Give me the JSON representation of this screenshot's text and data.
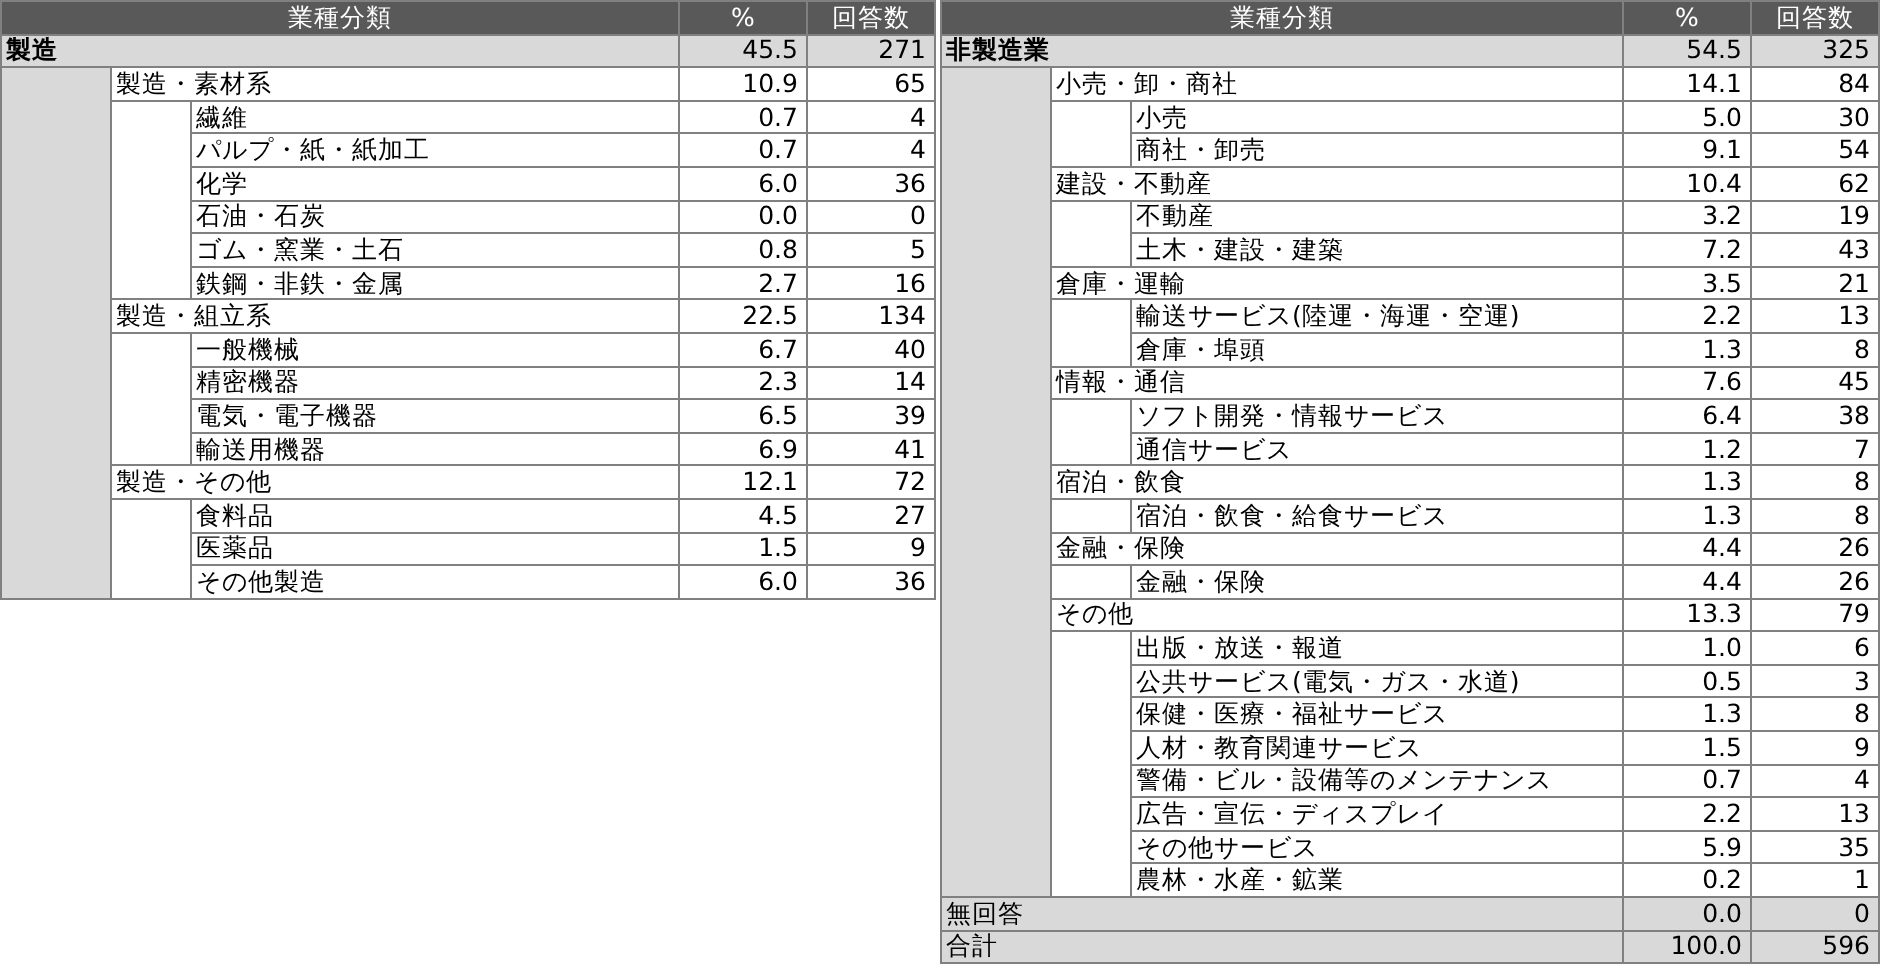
{
  "tables": [
    {
      "columns": [
        "業種分類",
        "%",
        "回答数"
      ],
      "rows": [
        {
          "kind": "sector",
          "label": "製造",
          "percent": "45.5",
          "count": "271",
          "children": [
            {
              "label": "製造・素材系",
              "percent": "10.9",
              "count": "65",
              "children": [
                {
                  "label": "繊維",
                  "percent": "0.7",
                  "count": "4"
                },
                {
                  "label": "パルプ・紙・紙加工",
                  "percent": "0.7",
                  "count": "4"
                },
                {
                  "label": "化学",
                  "percent": "6.0",
                  "count": "36"
                },
                {
                  "label": "石油・石炭",
                  "percent": "0.0",
                  "count": "0"
                },
                {
                  "label": "ゴム・窯業・土石",
                  "percent": "0.8",
                  "count": "5"
                },
                {
                  "label": "鉄鋼・非鉄・金属",
                  "percent": "2.7",
                  "count": "16"
                }
              ]
            },
            {
              "label": "製造・組立系",
              "percent": "22.5",
              "count": "134",
              "children": [
                {
                  "label": "一般機械",
                  "percent": "6.7",
                  "count": "40"
                },
                {
                  "label": "精密機器",
                  "percent": "2.3",
                  "count": "14"
                },
                {
                  "label": "電気・電子機器",
                  "percent": "6.5",
                  "count": "39"
                },
                {
                  "label": "輸送用機器",
                  "percent": "6.9",
                  "count": "41"
                }
              ]
            },
            {
              "label": "製造・その他",
              "percent": "12.1",
              "count": "72",
              "children": [
                {
                  "label": "食料品",
                  "percent": "4.5",
                  "count": "27"
                },
                {
                  "label": "医薬品",
                  "percent": "1.5",
                  "count": "9"
                },
                {
                  "label": "その他製造",
                  "percent": "6.0",
                  "count": "36"
                }
              ]
            }
          ]
        }
      ]
    },
    {
      "columns": [
        "業種分類",
        "%",
        "回答数"
      ],
      "rows": [
        {
          "kind": "sector",
          "label": "非製造業",
          "percent": "54.5",
          "count": "325",
          "children": [
            {
              "label": "小売・卸・商社",
              "percent": "14.1",
              "count": "84",
              "children": [
                {
                  "label": "小売",
                  "percent": "5.0",
                  "count": "30"
                },
                {
                  "label": "商社・卸売",
                  "percent": "9.1",
                  "count": "54"
                }
              ]
            },
            {
              "label": "建設・不動産",
              "percent": "10.4",
              "count": "62",
              "children": [
                {
                  "label": "不動産",
                  "percent": "3.2",
                  "count": "19"
                },
                {
                  "label": "土木・建設・建築",
                  "percent": "7.2",
                  "count": "43"
                }
              ]
            },
            {
              "label": "倉庫・運輸",
              "percent": "3.5",
              "count": "21",
              "children": [
                {
                  "label": "輸送サービス(陸運・海運・空運)",
                  "percent": "2.2",
                  "count": "13"
                },
                {
                  "label": "倉庫・埠頭",
                  "percent": "1.3",
                  "count": "8"
                }
              ]
            },
            {
              "label": "情報・通信",
              "percent": "7.6",
              "count": "45",
              "children": [
                {
                  "label": "ソフト開発・情報サービス",
                  "percent": "6.4",
                  "count": "38"
                },
                {
                  "label": "通信サービス",
                  "percent": "1.2",
                  "count": "7"
                }
              ]
            },
            {
              "label": "宿泊・飲食",
              "percent": "1.3",
              "count": "8",
              "children": [
                {
                  "label": "宿泊・飲食・給食サービス",
                  "percent": "1.3",
                  "count": "8"
                }
              ]
            },
            {
              "label": "金融・保険",
              "percent": "4.4",
              "count": "26",
              "children": [
                {
                  "label": "金融・保険",
                  "percent": "4.4",
                  "count": "26"
                }
              ]
            },
            {
              "label": "その他",
              "percent": "13.3",
              "count": "79",
              "children": [
                {
                  "label": "出版・放送・報道",
                  "percent": "1.0",
                  "count": "6"
                },
                {
                  "label": "公共サービス(電気・ガス・水道)",
                  "percent": "0.5",
                  "count": "3"
                },
                {
                  "label": "保健・医療・福祉サービス",
                  "percent": "1.3",
                  "count": "8"
                },
                {
                  "label": "人材・教育関連サービス",
                  "percent": "1.5",
                  "count": "9"
                },
                {
                  "label": "警備・ビル・設備等のメンテナンス",
                  "percent": "0.7",
                  "count": "4"
                },
                {
                  "label": "広告・宣伝・ディスプレイ",
                  "percent": "2.2",
                  "count": "13"
                },
                {
                  "label": "その他サービス",
                  "percent": "5.9",
                  "count": "35"
                },
                {
                  "label": "農林・水産・鉱業",
                  "percent": "0.2",
                  "count": "1"
                }
              ]
            }
          ]
        },
        {
          "kind": "summary",
          "label": "無回答",
          "percent": "0.0",
          "count": "0"
        },
        {
          "kind": "summary",
          "label": "合計",
          "percent": "100.0",
          "count": "596"
        }
      ]
    }
  ]
}
